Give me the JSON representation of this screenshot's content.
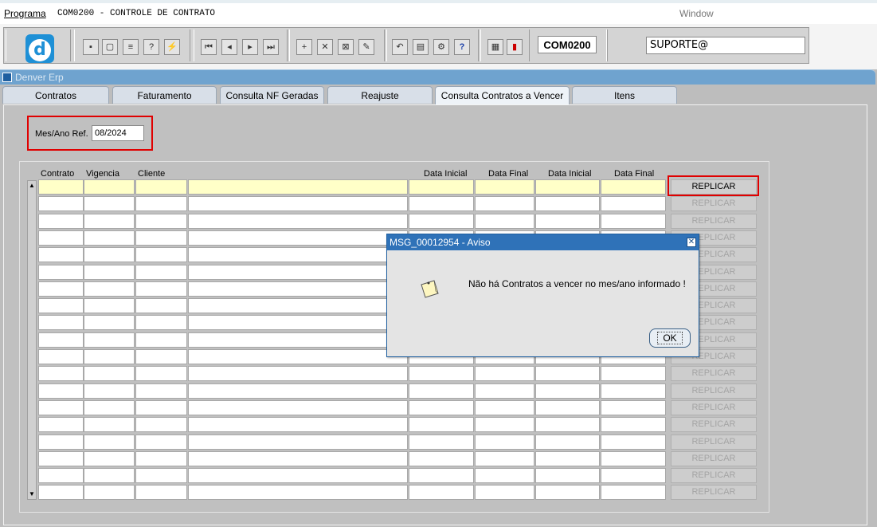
{
  "menubar": {
    "programa": "Programa",
    "title": "COM0200 - CONTROLE DE CONTRATO",
    "window": "Window"
  },
  "toolbar": {
    "program_code": "COM0200",
    "user": "SUPORTE@"
  },
  "app": {
    "title": "Denver Erp",
    "tabs": [
      {
        "label": "Contratos"
      },
      {
        "label": "Faturamento"
      },
      {
        "label": "Consulta NF Geradas"
      },
      {
        "label": "Reajuste"
      },
      {
        "label": "Consulta Contratos a Vencer"
      },
      {
        "label": "Itens"
      }
    ]
  },
  "filter": {
    "label": "Mes/Ano Ref.",
    "value": "08/2024"
  },
  "grid": {
    "headers": [
      "Contrato",
      "Vigencia",
      "Cliente",
      "Data Inicial",
      "Data Final",
      "Data Inicial",
      "Data Final"
    ],
    "replicar_label": "REPLICAR"
  },
  "dialog": {
    "title": "MSG_00012954 - Aviso",
    "message": "Não há Contratos a vencer no mes/ano informado !",
    "ok_label": "OK"
  }
}
